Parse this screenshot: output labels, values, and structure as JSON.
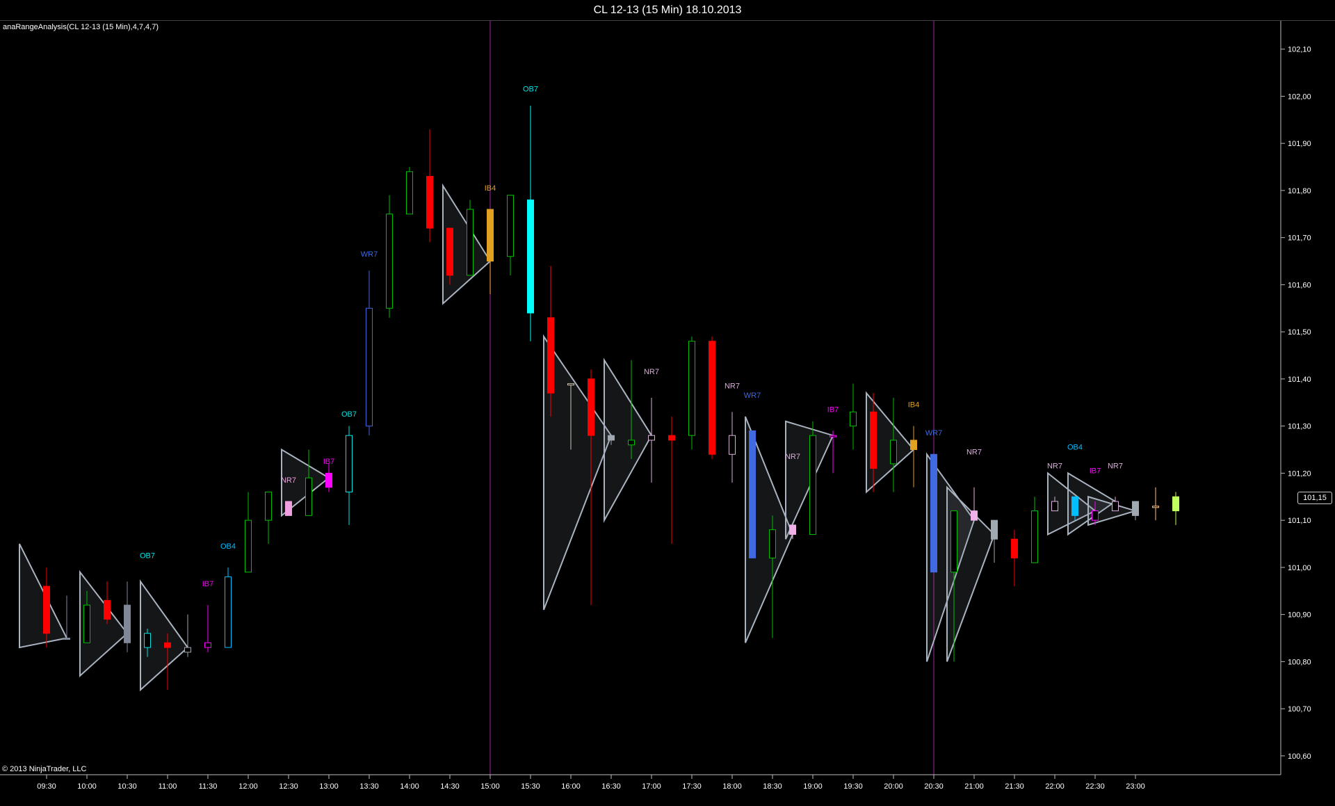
{
  "window": {
    "title": "CL 12-13 (15 Min)  18.10.2013"
  },
  "indicator_label": "anaRangeAnalysis(CL 12-13 (15 Min),4,7,4,7)",
  "copyright": "© 2013 NinjaTrader, LLC",
  "last_price": "101,15",
  "colors": {
    "background": "#000000",
    "up": "#00c000",
    "down": "#ff0000",
    "session_line": "#6a1b6a",
    "triangle": "#aab4c0",
    "neutral": "#808898"
  },
  "chart_data": {
    "type": "candlestick",
    "title": "CL 12-13 (15 Min)  18.10.2013",
    "ylim": [
      100.56,
      102.16
    ],
    "y_ticks": [
      "100,60",
      "100,70",
      "100,80",
      "100,90",
      "101,00",
      "101,10",
      "101,20",
      "101,30",
      "101,40",
      "101,50",
      "101,60",
      "101,70",
      "101,80",
      "101,90",
      "102,00",
      "102,10"
    ],
    "y_tick_values": [
      100.6,
      100.7,
      100.8,
      100.9,
      101.0,
      101.1,
      101.2,
      101.3,
      101.4,
      101.5,
      101.6,
      101.7,
      101.8,
      101.9,
      102.0,
      102.1
    ],
    "x_ticks": [
      "09:30",
      "10:00",
      "10:30",
      "11:00",
      "11:30",
      "12:00",
      "12:30",
      "13:00",
      "13:30",
      "14:00",
      "14:30",
      "15:00",
      "15:30",
      "16:00",
      "16:30",
      "17:00",
      "17:30",
      "18:00",
      "18:30",
      "19:00",
      "19:30",
      "20:00",
      "20:30",
      "21:00",
      "21:30",
      "22:00",
      "22:30",
      "23:00"
    ],
    "session_breaks": [
      "15:00",
      "20:30"
    ],
    "candles": [
      {
        "t": "09:30",
        "o": 100.96,
        "h": 101.0,
        "l": 100.83,
        "c": 100.86,
        "color": "#ff0000",
        "fill": true
      },
      {
        "t": "09:45",
        "o": 100.85,
        "h": 100.94,
        "l": 100.85,
        "c": 100.85,
        "color": "#808898",
        "fill": true
      },
      {
        "t": "10:00",
        "o": 100.84,
        "h": 100.95,
        "l": 100.84,
        "c": 100.92,
        "color": "#00c000",
        "fill": false
      },
      {
        "t": "10:15",
        "o": 100.93,
        "h": 100.97,
        "l": 100.88,
        "c": 100.89,
        "color": "#ff0000",
        "fill": true
      },
      {
        "t": "10:30",
        "o": 100.84,
        "h": 100.97,
        "l": 100.82,
        "c": 100.92,
        "color": "#808898",
        "fill": true
      },
      {
        "t": "10:45",
        "o": 100.83,
        "h": 100.87,
        "l": 100.81,
        "c": 100.86,
        "color": "#00e5e5",
        "fill": false
      },
      {
        "t": "11:00",
        "o": 100.84,
        "h": 100.86,
        "l": 100.74,
        "c": 100.83,
        "color": "#ff0000",
        "fill": true
      },
      {
        "t": "11:15",
        "o": 100.82,
        "h": 100.9,
        "l": 100.81,
        "c": 100.83,
        "color": "#a0a8b0",
        "fill": false
      },
      {
        "t": "11:30",
        "o": 100.83,
        "h": 100.92,
        "l": 100.82,
        "c": 100.84,
        "color": "#ff00ff",
        "fill": false
      },
      {
        "t": "11:45",
        "o": 100.83,
        "h": 101.0,
        "l": 100.83,
        "c": 100.98,
        "color": "#00bfff",
        "fill": false
      },
      {
        "t": "12:00",
        "o": 100.99,
        "h": 101.16,
        "l": 100.99,
        "c": 101.1,
        "color": "#00c000",
        "fill": false
      },
      {
        "t": "12:15",
        "o": 101.1,
        "h": 101.16,
        "l": 101.05,
        "c": 101.16,
        "color": "#00c000",
        "fill": false
      },
      {
        "t": "12:30",
        "o": 101.14,
        "h": 101.14,
        "l": 101.11,
        "c": 101.11,
        "color": "#f0a0e0",
        "fill": true
      },
      {
        "t": "12:45",
        "o": 101.11,
        "h": 101.25,
        "l": 101.11,
        "c": 101.19,
        "color": "#00c000",
        "fill": false
      },
      {
        "t": "13:00",
        "o": 101.2,
        "h": 101.22,
        "l": 101.16,
        "c": 101.17,
        "color": "#ff00ff",
        "fill": true
      },
      {
        "t": "13:15",
        "o": 101.16,
        "h": 101.3,
        "l": 101.09,
        "c": 101.28,
        "color": "#00e5e5",
        "fill": false
      },
      {
        "t": "13:30",
        "o": 101.3,
        "h": 101.63,
        "l": 101.28,
        "c": 101.55,
        "color": "#4169e1",
        "fill": false
      },
      {
        "t": "13:45",
        "o": 101.55,
        "h": 101.79,
        "l": 101.53,
        "c": 101.75,
        "color": "#00c000",
        "fill": false
      },
      {
        "t": "14:00",
        "o": 101.75,
        "h": 101.85,
        "l": 101.75,
        "c": 101.84,
        "color": "#00c000",
        "fill": false
      },
      {
        "t": "14:15",
        "o": 101.83,
        "h": 101.93,
        "l": 101.69,
        "c": 101.72,
        "color": "#ff0000",
        "fill": true
      },
      {
        "t": "14:30",
        "o": 101.72,
        "h": 101.72,
        "l": 101.6,
        "c": 101.62,
        "color": "#ff0000",
        "fill": true
      },
      {
        "t": "14:45",
        "o": 101.62,
        "h": 101.78,
        "l": 101.62,
        "c": 101.76,
        "color": "#00c000",
        "fill": false
      },
      {
        "t": "15:00",
        "o": 101.76,
        "h": 101.76,
        "l": 101.58,
        "c": 101.65,
        "color": "#e0a020",
        "fill": true
      },
      {
        "t": "15:15",
        "o": 101.66,
        "h": 101.79,
        "l": 101.62,
        "c": 101.79,
        "color": "#00c000",
        "fill": false
      },
      {
        "t": "15:30",
        "o": 101.78,
        "h": 101.98,
        "l": 101.48,
        "c": 101.54,
        "color": "#00ffff",
        "fill": true
      },
      {
        "t": "15:45",
        "o": 101.53,
        "h": 101.64,
        "l": 101.32,
        "c": 101.37,
        "color": "#ff0000",
        "fill": true
      },
      {
        "t": "16:00",
        "o": 101.39,
        "h": 101.39,
        "l": 101.25,
        "c": 101.39,
        "color": "#d0c8b8",
        "fill": false
      },
      {
        "t": "16:15",
        "o": 101.4,
        "h": 101.42,
        "l": 100.92,
        "c": 101.28,
        "color": "#ff0000",
        "fill": true
      },
      {
        "t": "16:30",
        "o": 101.27,
        "h": 101.28,
        "l": 101.26,
        "c": 101.28,
        "color": "#a0a8b0",
        "fill": true
      },
      {
        "t": "16:45",
        "o": 101.26,
        "h": 101.44,
        "l": 101.23,
        "c": 101.27,
        "color": "#00c000",
        "fill": false
      },
      {
        "t": "17:00",
        "o": 101.27,
        "h": 101.36,
        "l": 101.18,
        "c": 101.28,
        "color": "#d8b0d8",
        "fill": false
      },
      {
        "t": "17:15",
        "o": 101.28,
        "h": 101.32,
        "l": 101.05,
        "c": 101.27,
        "color": "#ff0000",
        "fill": true
      },
      {
        "t": "17:30",
        "o": 101.28,
        "h": 101.49,
        "l": 101.25,
        "c": 101.48,
        "color": "#00c000",
        "fill": false
      },
      {
        "t": "17:45",
        "o": 101.48,
        "h": 101.49,
        "l": 101.23,
        "c": 101.24,
        "color": "#ff0000",
        "fill": true
      },
      {
        "t": "18:00",
        "o": 101.24,
        "h": 101.33,
        "l": 101.18,
        "c": 101.28,
        "color": "#d8b0d8",
        "fill": false
      },
      {
        "t": "18:15",
        "o": 101.29,
        "h": 101.29,
        "l": 101.02,
        "c": 101.02,
        "color": "#4169e1",
        "fill": true
      },
      {
        "t": "18:30",
        "o": 101.02,
        "h": 101.11,
        "l": 100.85,
        "c": 101.08,
        "color": "#00c000",
        "fill": false
      },
      {
        "t": "18:45",
        "o": 101.07,
        "h": 101.09,
        "l": 101.06,
        "c": 101.09,
        "color": "#f0b0e8",
        "fill": true
      },
      {
        "t": "19:00",
        "o": 101.07,
        "h": 101.31,
        "l": 101.07,
        "c": 101.28,
        "color": "#00c000",
        "fill": false
      },
      {
        "t": "19:15",
        "o": 101.28,
        "h": 101.29,
        "l": 101.2,
        "c": 101.28,
        "color": "#ff00ff",
        "fill": false
      },
      {
        "t": "19:30",
        "o": 101.3,
        "h": 101.39,
        "l": 101.25,
        "c": 101.33,
        "color": "#00c000",
        "fill": false
      },
      {
        "t": "19:45",
        "o": 101.33,
        "h": 101.37,
        "l": 101.16,
        "c": 101.21,
        "color": "#ff0000",
        "fill": true
      },
      {
        "t": "20:00",
        "o": 101.22,
        "h": 101.36,
        "l": 101.16,
        "c": 101.27,
        "color": "#00c000",
        "fill": false
      },
      {
        "t": "20:15",
        "o": 101.27,
        "h": 101.3,
        "l": 101.17,
        "c": 101.25,
        "color": "#e0a020",
        "fill": true
      },
      {
        "t": "20:30",
        "o": 101.24,
        "h": 101.24,
        "l": 100.99,
        "c": 100.99,
        "color": "#4169e1",
        "fill": true
      },
      {
        "t": "20:45",
        "o": 100.99,
        "h": 101.12,
        "l": 100.8,
        "c": 101.12,
        "color": "#00c000",
        "fill": false
      },
      {
        "t": "21:00",
        "o": 101.12,
        "h": 101.17,
        "l": 101.1,
        "c": 101.1,
        "color": "#f0b0e8",
        "fill": true
      },
      {
        "t": "21:15",
        "o": 101.1,
        "h": 101.1,
        "l": 101.01,
        "c": 101.06,
        "color": "#a0a8b0",
        "fill": true
      },
      {
        "t": "21:30",
        "o": 101.06,
        "h": 101.08,
        "l": 100.96,
        "c": 101.02,
        "color": "#ff0000",
        "fill": true
      },
      {
        "t": "21:45",
        "o": 101.01,
        "h": 101.15,
        "l": 101.01,
        "c": 101.12,
        "color": "#00c000",
        "fill": false
      },
      {
        "t": "22:00",
        "o": 101.14,
        "h": 101.15,
        "l": 101.12,
        "c": 101.12,
        "color": "#e0b0e0",
        "fill": false
      },
      {
        "t": "22:15",
        "o": 101.15,
        "h": 101.15,
        "l": 101.1,
        "c": 101.11,
        "color": "#00bfff",
        "fill": true
      },
      {
        "t": "22:30",
        "o": 101.12,
        "h": 101.14,
        "l": 101.09,
        "c": 101.1,
        "color": "#ff00ff",
        "fill": false
      },
      {
        "t": "22:45",
        "o": 101.14,
        "h": 101.15,
        "l": 101.12,
        "c": 101.12,
        "color": "#e0b0e0",
        "fill": false
      },
      {
        "t": "23:00",
        "o": 101.14,
        "h": 101.14,
        "l": 101.1,
        "c": 101.11,
        "color": "#a0a8b0",
        "fill": true
      },
      {
        "t": "23:15",
        "o": 101.13,
        "h": 101.17,
        "l": 101.1,
        "c": 101.13,
        "color": "#ffc080",
        "fill": false
      },
      {
        "t": "23:30",
        "o": 101.12,
        "h": 101.16,
        "l": 101.09,
        "c": 101.15,
        "color": "#c0ff60",
        "fill": true
      }
    ],
    "annotations": [
      {
        "text": "OB7",
        "t": "10:45",
        "y": 101.02,
        "color": "#00e5e5"
      },
      {
        "text": "IB7",
        "t": "11:30",
        "y": 100.96,
        "color": "#ff00ff"
      },
      {
        "text": "OB4",
        "t": "11:45",
        "y": 101.04,
        "color": "#00bfff"
      },
      {
        "text": "NR7",
        "t": "12:30",
        "y": 101.18,
        "color": "#f0a0e0"
      },
      {
        "text": "IB7",
        "t": "13:00",
        "y": 101.22,
        "color": "#ff00ff"
      },
      {
        "text": "OB7",
        "t": "13:15",
        "y": 101.32,
        "color": "#00e5e5"
      },
      {
        "text": "WR7",
        "t": "13:30",
        "y": 101.66,
        "color": "#4169e1"
      },
      {
        "text": "IB4",
        "t": "15:00",
        "y": 101.8,
        "color": "#e0a020"
      },
      {
        "text": "OB7",
        "t": "15:30",
        "y": 102.01,
        "color": "#00e5e5"
      },
      {
        "text": "NR7",
        "t": "17:00",
        "y": 101.41,
        "color": "#d8b0d8"
      },
      {
        "text": "NR7",
        "t": "18:00",
        "y": 101.38,
        "color": "#d8b0d8"
      },
      {
        "text": "WR7",
        "t": "18:15",
        "y": 101.36,
        "color": "#4169e1"
      },
      {
        "text": "NR7",
        "t": "18:45",
        "y": 101.23,
        "color": "#d8b0d8"
      },
      {
        "text": "IB7",
        "t": "19:15",
        "y": 101.33,
        "color": "#ff00ff"
      },
      {
        "text": "IB4",
        "t": "20:15",
        "y": 101.34,
        "color": "#e0a020"
      },
      {
        "text": "WR7",
        "t": "20:30",
        "y": 101.28,
        "color": "#4169e1"
      },
      {
        "text": "NR7",
        "t": "21:00",
        "y": 101.24,
        "color": "#d8b0d8"
      },
      {
        "text": "NR7",
        "t": "22:00",
        "y": 101.21,
        "color": "#d8b0d8"
      },
      {
        "text": "OB4",
        "t": "22:15",
        "y": 101.25,
        "color": "#00bfff"
      },
      {
        "text": "IB7",
        "t": "22:30",
        "y": 101.2,
        "color": "#ff00ff"
      },
      {
        "text": "NR7",
        "t": "22:45",
        "y": 101.21,
        "color": "#d8b0d8"
      }
    ],
    "triangles": [
      {
        "t0": "09:15",
        "t1": "09:45",
        "hi": 101.05,
        "lo": 100.83,
        "end": 100.85
      },
      {
        "t0": "10:00",
        "t1": "10:30",
        "hi": 100.99,
        "lo": 100.77,
        "end": 100.86
      },
      {
        "t0": "10:45",
        "t1": "11:15",
        "hi": 100.97,
        "lo": 100.74,
        "end": 100.83
      },
      {
        "t0": "12:30",
        "t1": "13:00",
        "hi": 101.25,
        "lo": 101.11,
        "end": 101.19
      },
      {
        "t0": "14:30",
        "t1": "15:00",
        "hi": 101.81,
        "lo": 101.56,
        "end": 101.65
      },
      {
        "t0": "15:45",
        "t1": "16:30",
        "hi": 101.49,
        "lo": 100.91,
        "end": 101.28
      },
      {
        "t0": "16:30",
        "t1": "17:00",
        "hi": 101.44,
        "lo": 101.1,
        "end": 101.28
      },
      {
        "t0": "18:15",
        "t1": "18:45",
        "hi": 101.32,
        "lo": 100.84,
        "end": 101.07
      },
      {
        "t0": "18:45",
        "t1": "19:15",
        "hi": 101.31,
        "lo": 101.06,
        "end": 101.28
      },
      {
        "t0": "19:45",
        "t1": "20:15",
        "hi": 101.37,
        "lo": 101.16,
        "end": 101.25
      },
      {
        "t0": "20:30",
        "t1": "21:00",
        "hi": 101.24,
        "lo": 100.8,
        "end": 101.1
      },
      {
        "t0": "20:45",
        "t1": "21:15",
        "hi": 101.17,
        "lo": 100.8,
        "end": 101.07
      },
      {
        "t0": "22:00",
        "t1": "22:30",
        "hi": 101.2,
        "lo": 101.07,
        "end": 101.12
      },
      {
        "t0": "22:15",
        "t1": "22:45",
        "hi": 101.2,
        "lo": 101.07,
        "end": 101.14
      },
      {
        "t0": "22:30",
        "t1": "23:00",
        "hi": 101.15,
        "lo": 101.09,
        "end": 101.12
      }
    ]
  }
}
